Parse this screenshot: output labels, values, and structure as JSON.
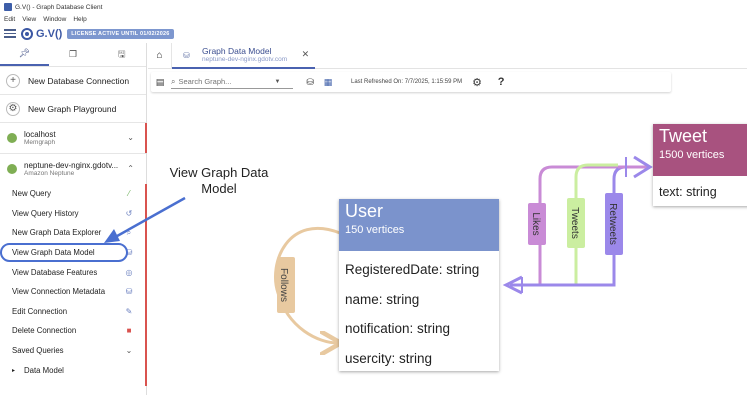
{
  "window": {
    "title": "G.V() - Graph Database Client"
  },
  "menubar": {
    "items": [
      "Edit",
      "View",
      "Window",
      "Help"
    ]
  },
  "brand": {
    "logo_text": "G.V()",
    "license_badge": "LICENSE ACTIVE UNTIL 01/02/2026"
  },
  "sidebar": {
    "new_connection": "New Database Connection",
    "new_playground": "New Graph Playground",
    "connections": [
      {
        "name": "localhost",
        "type": "Memgraph",
        "status_color": "#7fae54"
      },
      {
        "name": "neptune-dev-nginx.gdotv...",
        "type": "Amazon Neptune",
        "status_color": "#7fae54"
      }
    ],
    "menu": [
      {
        "label": "New Query",
        "icon": "wand-icon"
      },
      {
        "label": "View Query History",
        "icon": "history-icon"
      },
      {
        "label": "New Graph Data Explorer",
        "icon": "explore-icon"
      },
      {
        "label": "View Graph Data Model",
        "icon": "database-icon"
      },
      {
        "label": "View Database Features",
        "icon": "features-icon"
      },
      {
        "label": "View Connection Metadata",
        "icon": "database-icon"
      },
      {
        "label": "Edit Connection",
        "icon": "edit-icon"
      },
      {
        "label": "Delete Connection",
        "icon": "trash-icon"
      },
      {
        "label": "Saved Queries",
        "icon": "chevron-down-icon"
      }
    ],
    "data_model_label": "Data Model"
  },
  "tab": {
    "title": "Graph Data Model",
    "subtitle": "neptune-dev-nginx.gdotv.com"
  },
  "toolbar": {
    "search_placeholder": "Search Graph...",
    "last_refreshed": "Last Refreshed On: 7/7/2025, 1:15:59 PM",
    "help": "?"
  },
  "annotation": {
    "text": "View Graph Data Model"
  },
  "graph": {
    "user": {
      "name": "User",
      "count": "150 vertices",
      "color": "#7b93cc",
      "properties": [
        "RegisteredDate: string",
        "name: string",
        "notification: string",
        "usercity: string"
      ]
    },
    "tweet": {
      "name": "Tweet",
      "count": "1500 vertices",
      "color": "#a8527f",
      "properties": [
        "text: string"
      ]
    },
    "edges": [
      {
        "label": "Follows",
        "color": "#e8c9a0"
      },
      {
        "label": "Likes",
        "color": "#c98bd6"
      },
      {
        "label": "Tweets",
        "color": "#cbeea0"
      },
      {
        "label": "Retweets",
        "color": "#9b88ea"
      }
    ]
  }
}
